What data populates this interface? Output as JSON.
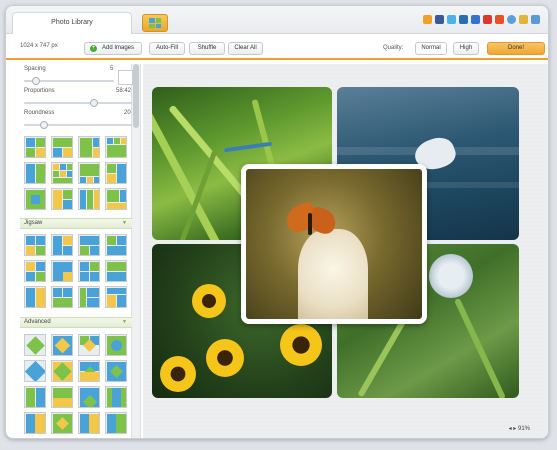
{
  "tabs": {
    "library": "Photo Library"
  },
  "toolbar": {
    "dimensions": "1024 x 747 px",
    "add_images": "Add Images",
    "auto_fill": "Auto-Fill",
    "shuffle": "Shuffle",
    "clear_all": "Clear All",
    "quality_label": "Quality:",
    "quality_normal": "Normal",
    "quality_high": "High",
    "done": "Done!"
  },
  "controls": {
    "spacing": {
      "label": "Spacing",
      "value": "5"
    },
    "proportions": {
      "label": "Proportions",
      "value": "58:42"
    },
    "roundness": {
      "label": "Roundness",
      "value": "20"
    }
  },
  "sections": {
    "jigsaw": "Jigsaw",
    "advanced": "Advanced"
  },
  "share_icons": [
    "home-icon",
    "facebook-icon",
    "twitter-icon",
    "digg-icon",
    "delicious-icon",
    "reddit-icon",
    "stumbleupon-icon",
    "globe-icon",
    "email-icon",
    "fullscreen-icon"
  ],
  "colors": {
    "accent": "#f0a12c",
    "thumb_blue": "#4aa3d8",
    "thumb_green": "#7ec24a",
    "thumb_yellow": "#f3c84a"
  },
  "status": {
    "zoom": "91%"
  }
}
